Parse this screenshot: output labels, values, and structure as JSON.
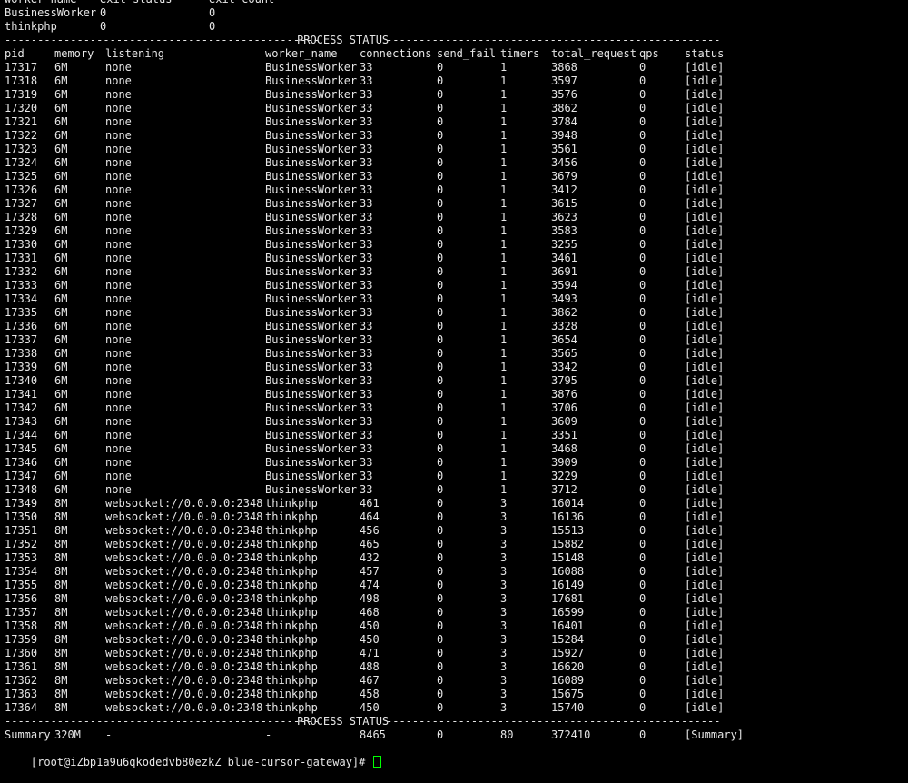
{
  "top": {
    "header": [
      "worker_name",
      "exit_status",
      "exit_count"
    ],
    "rows": [
      [
        "BusinessWorker",
        "0",
        "0"
      ],
      [
        "thinkphp",
        "0",
        "0"
      ]
    ]
  },
  "separator_label": "PROCESS STATUS",
  "columns": [
    "pid",
    "memory",
    "listening",
    "worker_name",
    "connections",
    "send_fail",
    "timers",
    "total_request",
    "qps",
    "status"
  ],
  "rows": [
    [
      "17317",
      "6M",
      "none",
      "BusinessWorker",
      "33",
      "0",
      "1",
      "3868",
      "0",
      "[idle]"
    ],
    [
      "17318",
      "6M",
      "none",
      "BusinessWorker",
      "33",
      "0",
      "1",
      "3597",
      "0",
      "[idle]"
    ],
    [
      "17319",
      "6M",
      "none",
      "BusinessWorker",
      "33",
      "0",
      "1",
      "3576",
      "0",
      "[idle]"
    ],
    [
      "17320",
      "6M",
      "none",
      "BusinessWorker",
      "33",
      "0",
      "1",
      "3862",
      "0",
      "[idle]"
    ],
    [
      "17321",
      "6M",
      "none",
      "BusinessWorker",
      "33",
      "0",
      "1",
      "3784",
      "0",
      "[idle]"
    ],
    [
      "17322",
      "6M",
      "none",
      "BusinessWorker",
      "33",
      "0",
      "1",
      "3948",
      "0",
      "[idle]"
    ],
    [
      "17323",
      "6M",
      "none",
      "BusinessWorker",
      "33",
      "0",
      "1",
      "3561",
      "0",
      "[idle]"
    ],
    [
      "17324",
      "6M",
      "none",
      "BusinessWorker",
      "33",
      "0",
      "1",
      "3456",
      "0",
      "[idle]"
    ],
    [
      "17325",
      "6M",
      "none",
      "BusinessWorker",
      "33",
      "0",
      "1",
      "3679",
      "0",
      "[idle]"
    ],
    [
      "17326",
      "6M",
      "none",
      "BusinessWorker",
      "33",
      "0",
      "1",
      "3412",
      "0",
      "[idle]"
    ],
    [
      "17327",
      "6M",
      "none",
      "BusinessWorker",
      "33",
      "0",
      "1",
      "3615",
      "0",
      "[idle]"
    ],
    [
      "17328",
      "6M",
      "none",
      "BusinessWorker",
      "33",
      "0",
      "1",
      "3623",
      "0",
      "[idle]"
    ],
    [
      "17329",
      "6M",
      "none",
      "BusinessWorker",
      "33",
      "0",
      "1",
      "3583",
      "0",
      "[idle]"
    ],
    [
      "17330",
      "6M",
      "none",
      "BusinessWorker",
      "33",
      "0",
      "1",
      "3255",
      "0",
      "[idle]"
    ],
    [
      "17331",
      "6M",
      "none",
      "BusinessWorker",
      "33",
      "0",
      "1",
      "3461",
      "0",
      "[idle]"
    ],
    [
      "17332",
      "6M",
      "none",
      "BusinessWorker",
      "33",
      "0",
      "1",
      "3691",
      "0",
      "[idle]"
    ],
    [
      "17333",
      "6M",
      "none",
      "BusinessWorker",
      "33",
      "0",
      "1",
      "3594",
      "0",
      "[idle]"
    ],
    [
      "17334",
      "6M",
      "none",
      "BusinessWorker",
      "33",
      "0",
      "1",
      "3493",
      "0",
      "[idle]"
    ],
    [
      "17335",
      "6M",
      "none",
      "BusinessWorker",
      "33",
      "0",
      "1",
      "3862",
      "0",
      "[idle]"
    ],
    [
      "17336",
      "6M",
      "none",
      "BusinessWorker",
      "33",
      "0",
      "1",
      "3328",
      "0",
      "[idle]"
    ],
    [
      "17337",
      "6M",
      "none",
      "BusinessWorker",
      "33",
      "0",
      "1",
      "3654",
      "0",
      "[idle]"
    ],
    [
      "17338",
      "6M",
      "none",
      "BusinessWorker",
      "33",
      "0",
      "1",
      "3565",
      "0",
      "[idle]"
    ],
    [
      "17339",
      "6M",
      "none",
      "BusinessWorker",
      "33",
      "0",
      "1",
      "3342",
      "0",
      "[idle]"
    ],
    [
      "17340",
      "6M",
      "none",
      "BusinessWorker",
      "33",
      "0",
      "1",
      "3795",
      "0",
      "[idle]"
    ],
    [
      "17341",
      "6M",
      "none",
      "BusinessWorker",
      "33",
      "0",
      "1",
      "3876",
      "0",
      "[idle]"
    ],
    [
      "17342",
      "6M",
      "none",
      "BusinessWorker",
      "33",
      "0",
      "1",
      "3706",
      "0",
      "[idle]"
    ],
    [
      "17343",
      "6M",
      "none",
      "BusinessWorker",
      "33",
      "0",
      "1",
      "3609",
      "0",
      "[idle]"
    ],
    [
      "17344",
      "6M",
      "none",
      "BusinessWorker",
      "33",
      "0",
      "1",
      "3351",
      "0",
      "[idle]"
    ],
    [
      "17345",
      "6M",
      "none",
      "BusinessWorker",
      "33",
      "0",
      "1",
      "3468",
      "0",
      "[idle]"
    ],
    [
      "17346",
      "6M",
      "none",
      "BusinessWorker",
      "33",
      "0",
      "1",
      "3909",
      "0",
      "[idle]"
    ],
    [
      "17347",
      "6M",
      "none",
      "BusinessWorker",
      "33",
      "0",
      "1",
      "3229",
      "0",
      "[idle]"
    ],
    [
      "17348",
      "6M",
      "none",
      "BusinessWorker",
      "33",
      "0",
      "1",
      "3712",
      "0",
      "[idle]"
    ],
    [
      "17349",
      "8M",
      "websocket://0.0.0.0:2348",
      "thinkphp",
      "461",
      "0",
      "3",
      "16014",
      "0",
      "[idle]"
    ],
    [
      "17350",
      "8M",
      "websocket://0.0.0.0:2348",
      "thinkphp",
      "464",
      "0",
      "3",
      "16136",
      "0",
      "[idle]"
    ],
    [
      "17351",
      "8M",
      "websocket://0.0.0.0:2348",
      "thinkphp",
      "456",
      "0",
      "3",
      "15513",
      "0",
      "[idle]"
    ],
    [
      "17352",
      "8M",
      "websocket://0.0.0.0:2348",
      "thinkphp",
      "465",
      "0",
      "3",
      "15882",
      "0",
      "[idle]"
    ],
    [
      "17353",
      "8M",
      "websocket://0.0.0.0:2348",
      "thinkphp",
      "432",
      "0",
      "3",
      "15148",
      "0",
      "[idle]"
    ],
    [
      "17354",
      "8M",
      "websocket://0.0.0.0:2348",
      "thinkphp",
      "457",
      "0",
      "3",
      "16088",
      "0",
      "[idle]"
    ],
    [
      "17355",
      "8M",
      "websocket://0.0.0.0:2348",
      "thinkphp",
      "474",
      "0",
      "3",
      "16149",
      "0",
      "[idle]"
    ],
    [
      "17356",
      "8M",
      "websocket://0.0.0.0:2348",
      "thinkphp",
      "498",
      "0",
      "3",
      "17681",
      "0",
      "[idle]"
    ],
    [
      "17357",
      "8M",
      "websocket://0.0.0.0:2348",
      "thinkphp",
      "468",
      "0",
      "3",
      "16599",
      "0",
      "[idle]"
    ],
    [
      "17358",
      "8M",
      "websocket://0.0.0.0:2348",
      "thinkphp",
      "450",
      "0",
      "3",
      "16401",
      "0",
      "[idle]"
    ],
    [
      "17359",
      "8M",
      "websocket://0.0.0.0:2348",
      "thinkphp",
      "450",
      "0",
      "3",
      "15284",
      "0",
      "[idle]"
    ],
    [
      "17360",
      "8M",
      "websocket://0.0.0.0:2348",
      "thinkphp",
      "471",
      "0",
      "3",
      "15927",
      "0",
      "[idle]"
    ],
    [
      "17361",
      "8M",
      "websocket://0.0.0.0:2348",
      "thinkphp",
      "488",
      "0",
      "3",
      "16620",
      "0",
      "[idle]"
    ],
    [
      "17362",
      "8M",
      "websocket://0.0.0.0:2348",
      "thinkphp",
      "467",
      "0",
      "3",
      "16089",
      "0",
      "[idle]"
    ],
    [
      "17363",
      "8M",
      "websocket://0.0.0.0:2348",
      "thinkphp",
      "458",
      "0",
      "3",
      "15675",
      "0",
      "[idle]"
    ],
    [
      "17364",
      "8M",
      "websocket://0.0.0.0:2348",
      "thinkphp",
      "450",
      "0",
      "3",
      "15740",
      "0",
      "[idle]"
    ]
  ],
  "summary": [
    "Summary",
    "320M",
    "-",
    "-",
    "8465",
    "0",
    "80",
    "372410",
    "0",
    "[Summary]"
  ],
  "prompt": "[root@iZbp1a9u6qkodedvb80ezkZ blue-cursor-gateway]# ",
  "colors": {
    "background": "#000000",
    "text": "#e6e6e6",
    "cursor": "#00ff00"
  }
}
